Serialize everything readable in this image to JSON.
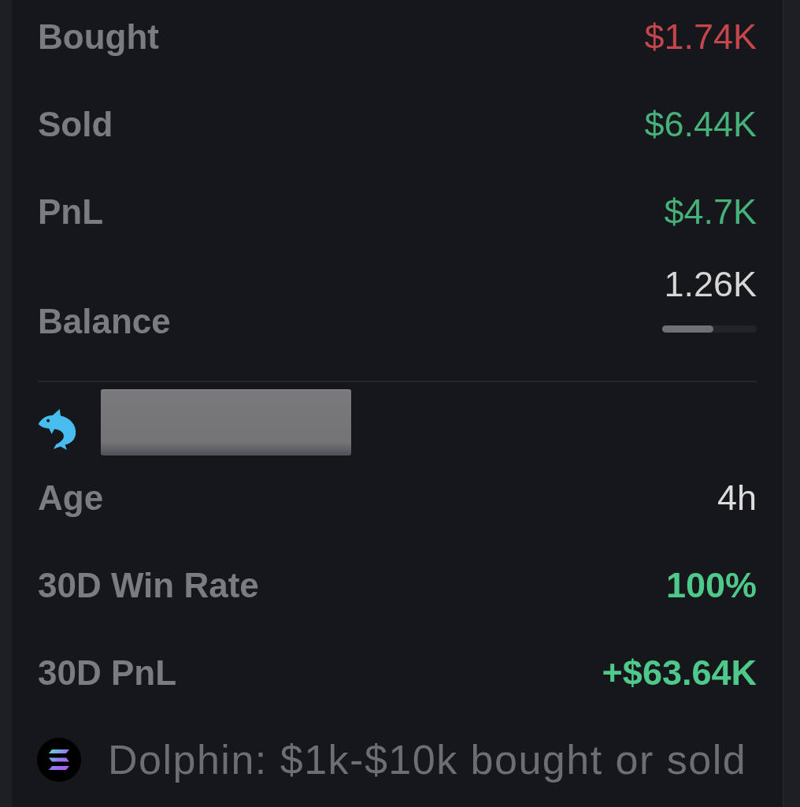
{
  "trade_stats": [
    {
      "label": "Bought",
      "value": "$1.74K",
      "color": "#c6464e"
    },
    {
      "label": "Sold",
      "value": "$6.44K",
      "color": "#46b17b"
    },
    {
      "label": "PnL",
      "value": "$4.7K",
      "color": "#46b17b"
    }
  ],
  "balance": {
    "label": "Balance",
    "value": "1.26K",
    "level": 0.54
  },
  "wallet_stats": [
    {
      "label": "Age",
      "value": "4h",
      "color": "#dcdcdc",
      "bold": false
    },
    {
      "label": "30D Win Rate",
      "value": "100%",
      "color": "#4fc98b",
      "bold": true
    },
    {
      "label": "30D PnL",
      "value": "+$63.64K",
      "color": "#4fc98b",
      "bold": true
    }
  ],
  "footer": {
    "text": "Dolphin: $1k-$10k bought or sold"
  }
}
